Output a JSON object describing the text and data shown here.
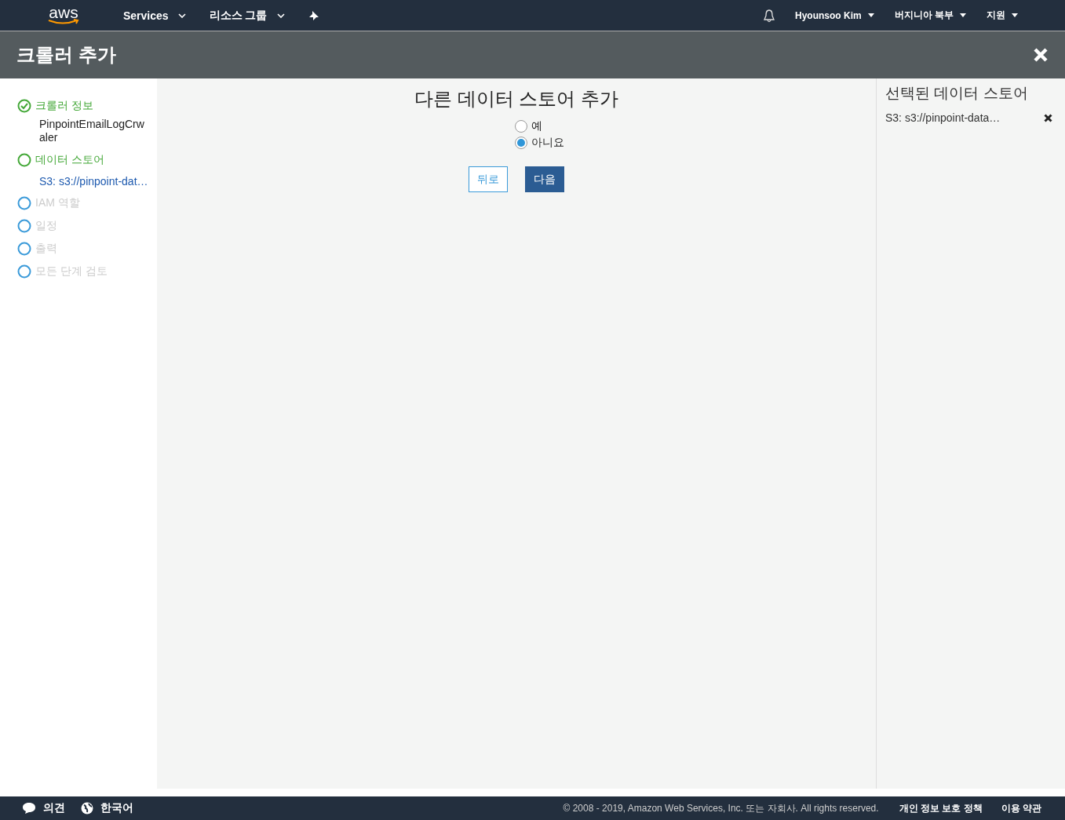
{
  "navbar": {
    "logo": "aws",
    "menus": [
      {
        "label": "Services"
      },
      {
        "label": "리소스 그룹"
      }
    ],
    "user_menus": [
      {
        "label": "Hyounsoo Kim"
      },
      {
        "label": "버지니아 북부"
      },
      {
        "label": "지원"
      }
    ]
  },
  "header": {
    "title": "크롤러 추가"
  },
  "steps": [
    {
      "label": "크롤러 정보",
      "completed": true,
      "reached": true,
      "detail": "PinpointEmailLogCrwaler"
    },
    {
      "label": "데이터 스토어",
      "completed": false,
      "reached": true,
      "link": "S3: s3://pinpoint-dat…"
    },
    {
      "label": "IAM 역할",
      "completed": false,
      "reached": false
    },
    {
      "label": "일정",
      "completed": false,
      "reached": false
    },
    {
      "label": "출력",
      "completed": false,
      "reached": false
    },
    {
      "label": "모든 단계 검토",
      "completed": false,
      "reached": false
    }
  ],
  "main": {
    "title": "다른 데이터 스토어 추가",
    "options": [
      {
        "label": "예",
        "selected": false
      },
      {
        "label": "아니요",
        "selected": true
      }
    ],
    "back_button": "뒤로",
    "next_button": "다음"
  },
  "aside": {
    "title": "선택된 데이터 스토어",
    "items": [
      {
        "label": "S3: s3://pinpoint-data…"
      }
    ]
  },
  "footer": {
    "feedback": "의견",
    "language": "한국어",
    "copyright": "© 2008 - 2019, Amazon Web Services, Inc. 또는 자회사. All rights reserved.",
    "links": [
      "개인 정보 보호 정책",
      "이용 약관"
    ]
  }
}
